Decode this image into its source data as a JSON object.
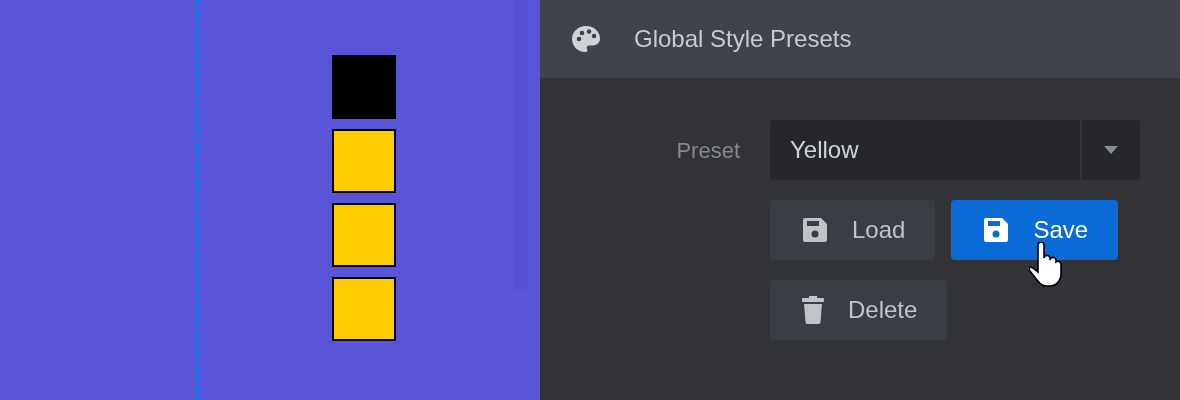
{
  "canvas": {
    "swatches": [
      {
        "color": "#000000"
      },
      {
        "color": "#ffcc00"
      },
      {
        "color": "#ffcc00"
      },
      {
        "color": "#ffcc00"
      }
    ]
  },
  "panel": {
    "title": "Global Style Presets",
    "preset": {
      "label": "Preset",
      "value": "Yellow"
    },
    "buttons": [
      {
        "label": "Load",
        "kind": "secondary",
        "hovered": false
      },
      {
        "label": "Save",
        "kind": "primary",
        "hovered": true
      },
      {
        "label": "Delete",
        "kind": "secondary",
        "hovered": false
      }
    ]
  }
}
